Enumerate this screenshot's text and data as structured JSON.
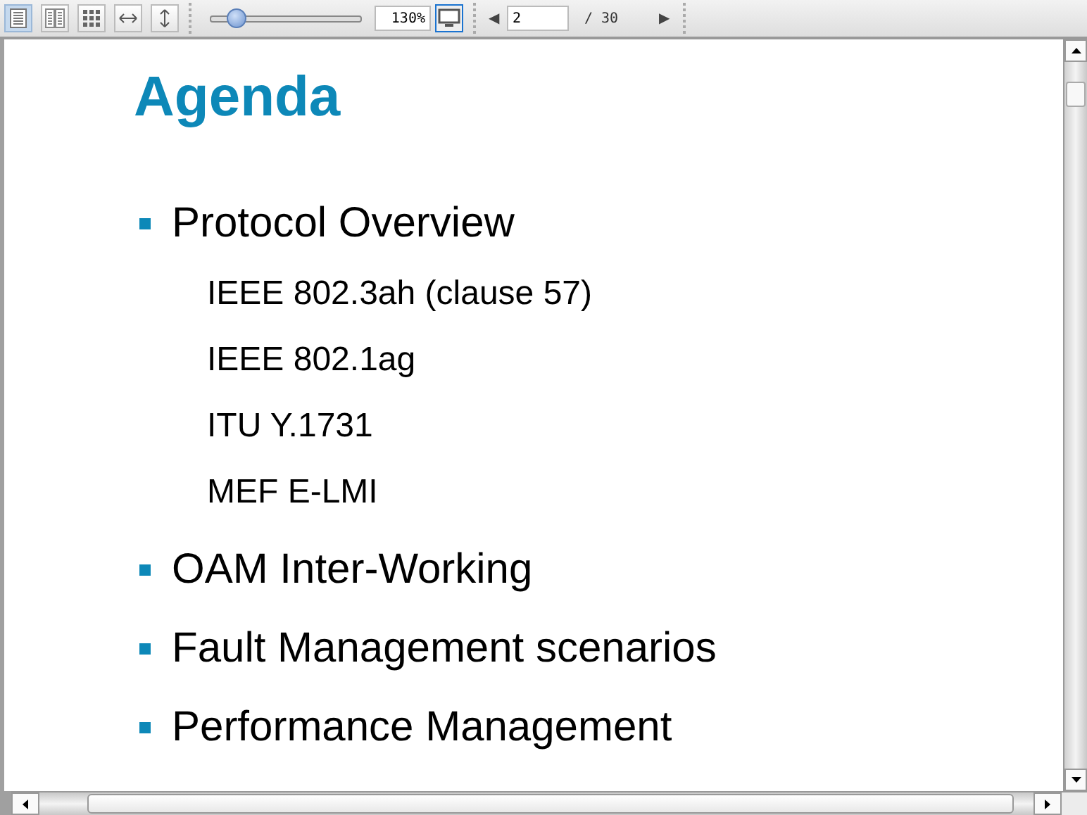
{
  "toolbar": {
    "view_modes": [
      {
        "kind": "single",
        "selected": true
      },
      {
        "kind": "double",
        "selected": false
      },
      {
        "kind": "grid",
        "selected": false
      },
      {
        "kind": "fit-width",
        "selected": false
      },
      {
        "kind": "fit-height",
        "selected": false
      }
    ],
    "zoom": {
      "level": 0.18,
      "value": "130%"
    },
    "fullscreen": {
      "selected": true
    },
    "page": {
      "prev": "◀",
      "value": "2",
      "total": "/ 30",
      "next": "▶"
    }
  },
  "slide": {
    "title": "Agenda",
    "bullets": [
      {
        "text": "Protocol Overview",
        "children": [
          {
            "text": "IEEE 802.3ah (clause 57)"
          },
          {
            "text": "IEEE 802.1ag"
          },
          {
            "text": "ITU Y.1731"
          },
          {
            "text": "MEF E-LMI"
          }
        ]
      },
      {
        "text": "OAM Inter-Working"
      },
      {
        "text": "Fault Management scenarios"
      },
      {
        "text": "Performance Management"
      }
    ]
  }
}
